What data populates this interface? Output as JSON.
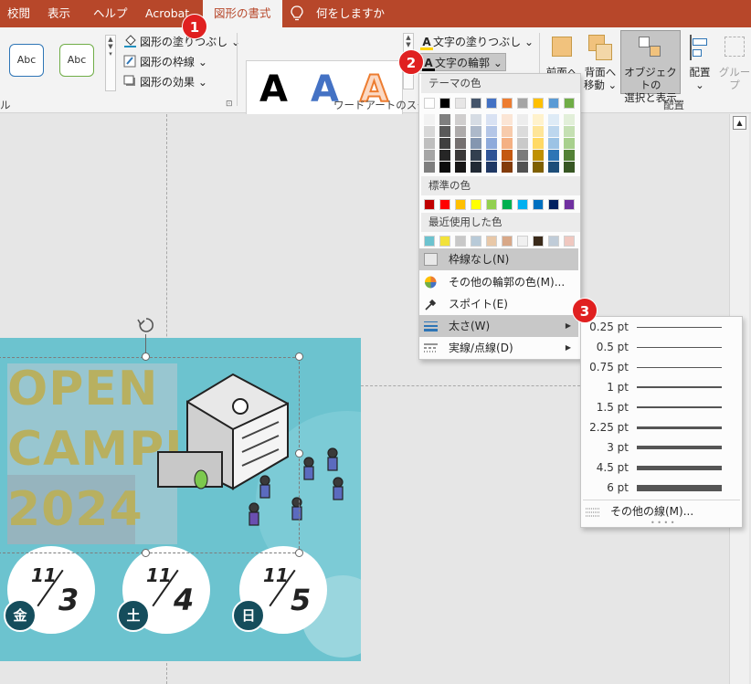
{
  "tabs": [
    {
      "label": "校閲"
    },
    {
      "label": "表示"
    },
    {
      "label": "ヘルプ"
    },
    {
      "label": "Acrobat"
    },
    {
      "label": "図形の書式"
    },
    {
      "label": "何をしますか"
    }
  ],
  "ribbon": {
    "shape_styles": {
      "samples": [
        "Abc",
        "Abc"
      ],
      "fill": "図形の塗りつぶし",
      "outline": "図形の枠線",
      "effects": "図形の効果",
      "group_label": "ル"
    },
    "wordart": {
      "letters": [
        "A",
        "A",
        "A"
      ],
      "text_fill": "文字の塗りつぶし",
      "text_outline": "文字の輪郭",
      "group_label": "ワードアートのスタイル"
    },
    "arrange": {
      "bring_forward": "前面へ",
      "send_backward_line1": "背面へ",
      "send_backward_line2": "移動",
      "selection_pane_line1": "オブジェクトの",
      "selection_pane_line2": "選択と表示",
      "align": "配置",
      "group": "グループ",
      "group_label": "配置"
    }
  },
  "outline_menu": {
    "theme_colors_header": "テーマの色",
    "standard_colors_header": "標準の色",
    "recent_colors_header": "最近使用した色",
    "no_outline": "枠線なし(N)",
    "more_colors": "その他の輪郭の色(M)...",
    "eyedropper": "スポイト(E)",
    "weight": "太さ(W)",
    "dashes": "実線/点線(D)"
  },
  "weight_menu": {
    "items": [
      "0.25 pt",
      "0.5 pt",
      "0.75 pt",
      "1 pt",
      "1.5 pt",
      "2.25 pt",
      "3 pt",
      "4.5 pt",
      "6 pt"
    ],
    "more_lines": "その他の線(M)..."
  },
  "slide": {
    "title_lines": [
      "OPEN",
      "CAMPUS",
      "2024"
    ],
    "dates": [
      {
        "month": "11",
        "day": "3",
        "weekday": "金"
      },
      {
        "month": "11",
        "day": "4",
        "weekday": "土"
      },
      {
        "month": "11",
        "day": "5",
        "weekday": "日"
      }
    ]
  },
  "steps": [
    "1",
    "2",
    "3"
  ],
  "colors": {
    "accent": "#b7472a",
    "slide_bg": "#6cc3cf",
    "wordart_text": "#b8b060",
    "step_badge": "#e02020",
    "standard": [
      "#c00000",
      "#ff0000",
      "#ffc000",
      "#ffff00",
      "#92d050",
      "#00b050",
      "#00b0f0",
      "#0070c0",
      "#002060",
      "#7030a0"
    ],
    "recent": [
      "#6cc3cf",
      "#f2e23a",
      "#c8c8c8",
      "#b8cad8",
      "#e8c8a8",
      "#d8a888",
      "#f0f0f0",
      "#3a2a1a",
      "#c0ccd8",
      "#f0c8c0"
    ]
  }
}
